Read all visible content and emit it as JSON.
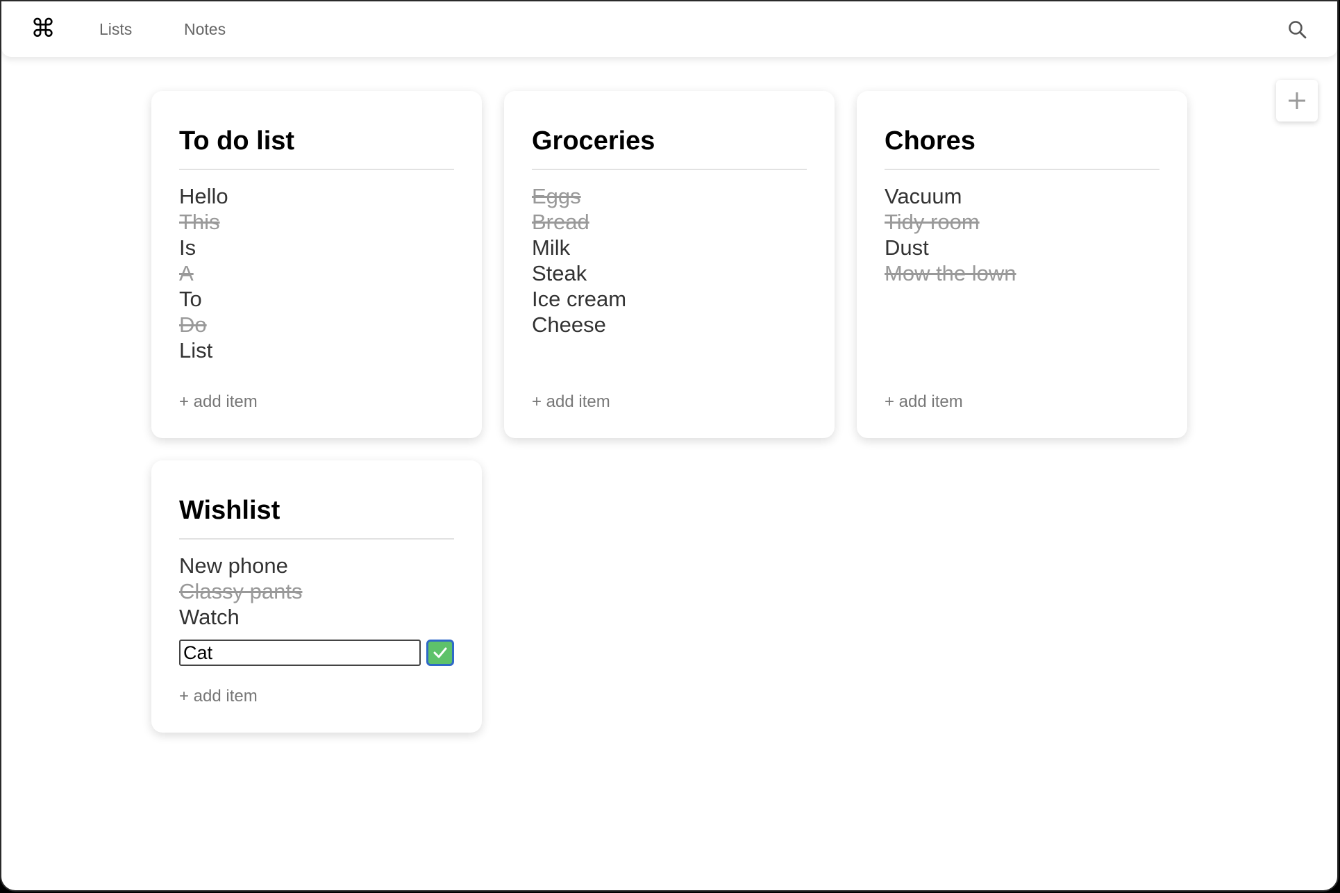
{
  "nav": {
    "logo_glyph": "⌘",
    "links": [
      "Lists",
      "Notes"
    ],
    "search_icon": "search-icon",
    "add_list_icon": "plus-icon"
  },
  "lists": [
    {
      "title": "To do list",
      "items": [
        {
          "text": "Hello",
          "done": false
        },
        {
          "text": "This",
          "done": true
        },
        {
          "text": "Is",
          "done": false
        },
        {
          "text": "A",
          "done": true
        },
        {
          "text": "To",
          "done": false
        },
        {
          "text": "Do",
          "done": true
        },
        {
          "text": "List",
          "done": false
        }
      ],
      "add_label": "+ add item"
    },
    {
      "title": "Groceries",
      "items": [
        {
          "text": "Eggs",
          "done": true
        },
        {
          "text": "Bread",
          "done": true
        },
        {
          "text": "Milk",
          "done": false
        },
        {
          "text": "Steak",
          "done": false
        },
        {
          "text": "Ice cream",
          "done": false
        },
        {
          "text": "Cheese",
          "done": false
        }
      ],
      "add_label": "+ add item"
    },
    {
      "title": "Chores",
      "items": [
        {
          "text": "Vacuum",
          "done": false
        },
        {
          "text": "Tidy room",
          "done": true
        },
        {
          "text": "Dust",
          "done": false
        },
        {
          "text": "Mow the lown",
          "done": true
        }
      ],
      "add_label": "+ add item"
    },
    {
      "title": "Wishlist",
      "items": [
        {
          "text": "New phone",
          "done": false
        },
        {
          "text": "Classy pants",
          "done": true
        },
        {
          "text": "Watch",
          "done": false
        }
      ],
      "new_item_value": "Cat",
      "add_label": "+ add item"
    }
  ],
  "colors": {
    "confirm_button": "#5ec26a",
    "confirm_border": "#2f69c7",
    "done_text": "#999999"
  }
}
